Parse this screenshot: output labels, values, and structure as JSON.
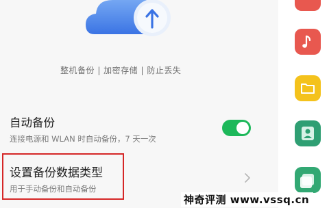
{
  "hero": {
    "caption": "整机备份 | 加密存储 | 防止丢失",
    "cloud_icon": "cloud-upload-icon"
  },
  "auto_backup": {
    "title": "自动备份",
    "subtitle": "连接电源和 WLAN 时自动备份，7 天一次",
    "enabled": true
  },
  "backup_type": {
    "title": "设置备份数据类型",
    "subtitle": "用于手动备份和自动备份"
  },
  "dock": {
    "apps": [
      {
        "icon": "red-app-icon",
        "color": "#e8584f"
      },
      {
        "icon": "music-icon",
        "color": "#e8584f"
      },
      {
        "icon": "folder-icon",
        "color": "#f4c21c"
      },
      {
        "icon": "contacts-icon",
        "color": "#2f9f73"
      },
      {
        "icon": "gallery-icon",
        "color": "#32a873"
      }
    ]
  },
  "watermark": "神奇评测 www.vssq.cn",
  "colors": {
    "toggle_on": "#1db85a",
    "highlight_border": "#d52626",
    "cloud_blue": "#4a86ea"
  }
}
